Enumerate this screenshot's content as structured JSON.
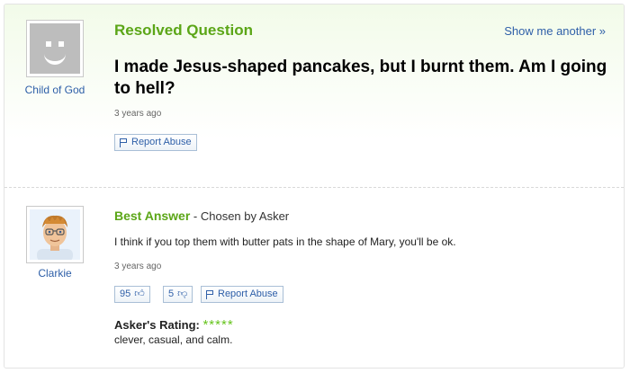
{
  "question": {
    "heading": "Resolved Question",
    "show_another": "Show me another »",
    "title": "I made Jesus-shaped pancakes, but I burnt them. Am I going to hell?",
    "time": "3 years ago",
    "report_label": "Report Abuse",
    "asker": {
      "name": "Child of God",
      "avatar_icon": "default-avatar-icon"
    }
  },
  "answer": {
    "heading": "Best Answer",
    "chosen_by": " - Chosen by Asker",
    "text": "I think if you top them with butter pats in the shape of Mary, you'll be ok.",
    "time": "3 years ago",
    "thumbs_up": "95",
    "thumbs_down": "5",
    "report_label": "Report Abuse",
    "answerer": {
      "name": "Clarkie",
      "avatar_icon": "cartoon-avatar-icon"
    },
    "rating_label": "Asker's Rating:",
    "rating_stars": "*****",
    "rating_value": 5,
    "rating_comment": "clever, casual, and calm."
  },
  "colors": {
    "accent_green": "#5ba617",
    "link_blue": "#2e5fa8",
    "star_green": "#66c41d"
  }
}
